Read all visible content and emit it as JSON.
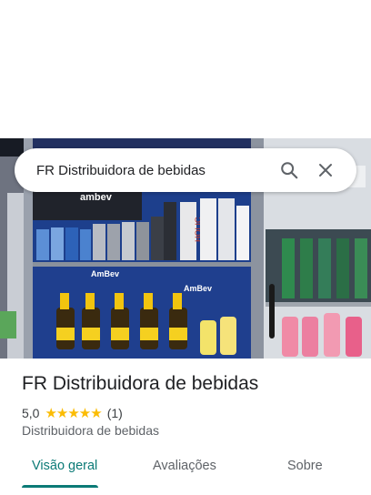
{
  "search": {
    "query": "FR Distribuidora de bebidas"
  },
  "place": {
    "title": "FR Distribuidora de bebidas",
    "rating": "5,0",
    "stars": "★★★★★",
    "review_count": "(1)",
    "category": "Distribuidora de bebidas"
  },
  "photo": {
    "brand_text": "ambev",
    "shelf_label_1": "AmBev",
    "shelf_label_2": "AmBev",
    "bottle_label": "HOLIC"
  },
  "tabs": [
    {
      "label": "Visão geral",
      "active": true
    },
    {
      "label": "Avaliações",
      "active": false
    },
    {
      "label": "Sobre",
      "active": false
    }
  ],
  "colors": {
    "accent": "#0b7a76",
    "star": "#fbbc04"
  },
  "icons": {
    "search": "search-icon",
    "close": "close-icon"
  }
}
